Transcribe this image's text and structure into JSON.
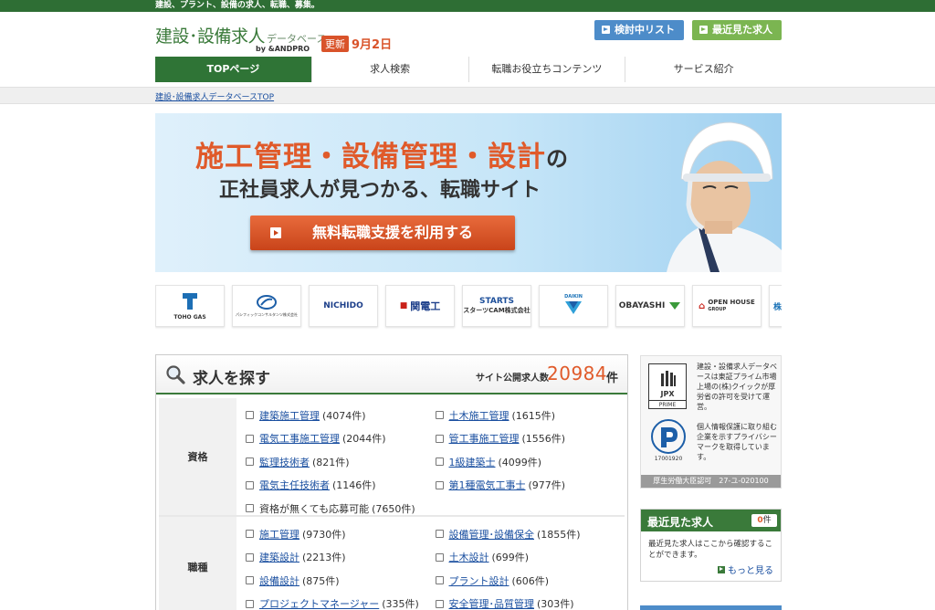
{
  "topbar": {
    "tagline": "建設、プラント、設備の求人、転職、募集。"
  },
  "header": {
    "logo_main": "建設･設備求人",
    "logo_sub": "データベース",
    "logo_by": "by &ANDPRO",
    "update_tag": "更新",
    "update_date": "9月2日",
    "btn_list": "検討中リスト",
    "btn_recent": "最近見た求人",
    "colors": {
      "brand_green": "#2f7436",
      "accent_orange": "#e05a2a",
      "btn_blue": "#4d8cc9",
      "btn_green": "#7bb551"
    }
  },
  "nav": [
    {
      "label": "TOPページ",
      "active": true
    },
    {
      "label": "求人検索"
    },
    {
      "label": "転職お役立ちコンテンツ"
    },
    {
      "label": "サービス紹介"
    }
  ],
  "breadcrumb": "建設･設備求人データベースTOP",
  "hero": {
    "headline": "施工管理・設備管理・設計",
    "headline_suffix": "の",
    "subline": "正社員求人が見つかる、転職サイト",
    "cta": "無料転職支援を利用する"
  },
  "logos": [
    {
      "name": "TOHO GAS"
    },
    {
      "name": "パシフィックコンサルタンツ株式会社"
    },
    {
      "name": "NICHIDO"
    },
    {
      "name": "関電工"
    },
    {
      "name": "STARTS"
    },
    {
      "name": "スターツCAM株式会社"
    },
    {
      "name": "DAIKIN"
    },
    {
      "name": "OBAYASHI"
    },
    {
      "name": "OPEN HOUSE"
    },
    {
      "name": "GROUP"
    },
    {
      "name": "株式会社"
    }
  ],
  "search": {
    "title": "求人を探す",
    "count_label": "サイト公開求人数",
    "count": "20984",
    "count_unit": "件",
    "rows": [
      {
        "label": "資格",
        "options": [
          {
            "text": "建築施工管理",
            "count": "(4074件)",
            "link": true
          },
          {
            "text": "土木施工管理",
            "count": "(1615件)",
            "link": true
          },
          {
            "text": "電気工事施工管理",
            "count": "(2044件)",
            "link": true
          },
          {
            "text": "管工事施工管理",
            "count": "(1556件)",
            "link": true
          },
          {
            "text": "監理技術者",
            "count": "(821件)",
            "link": true
          },
          {
            "text": "1級建築士",
            "count": "(4099件)",
            "link": true
          },
          {
            "text": "電気主任技術者",
            "count": "(1146件)",
            "link": true
          },
          {
            "text": "第1種電気工事士",
            "count": "(977件)",
            "link": true
          },
          {
            "text": "資格が無くても応募可能",
            "count": "(7650件)",
            "link": false
          }
        ]
      },
      {
        "label": "職種",
        "options": [
          {
            "text": "施工管理",
            "count": "(9730件)",
            "link": true
          },
          {
            "text": "設備管理･設備保全",
            "count": "(1855件)",
            "link": true
          },
          {
            "text": "建築設計",
            "count": "(2213件)",
            "link": true
          },
          {
            "text": "土木設計",
            "count": "(699件)",
            "link": true
          },
          {
            "text": "設備設計",
            "count": "(875件)",
            "link": true
          },
          {
            "text": "プラント設計",
            "count": "(606件)",
            "link": true
          },
          {
            "text": "プロジェクトマネージャー",
            "count": "(335件)",
            "link": true
          },
          {
            "text": "安全管理･品質管理",
            "count": "(303件)",
            "link": true
          }
        ]
      }
    ]
  },
  "sidebar": {
    "jpx_title": "JPX",
    "jpx_sub": "PRIME",
    "jpx_text": "建設・設備求人データベースは東証プライム市場上場の(株)クイックが厚労省の許可を受けて運営。",
    "privacy_text": "個人情報保護に取り組む企業を示すプライバシーマークを取得しています。",
    "privacy_no": "17001920",
    "license": "厚生労働大臣認可　27-ユ-020100",
    "recent_title": "最近見た求人",
    "recent_count": "0",
    "recent_unit": "件",
    "recent_body": "最近見た求人はここから確認することができます。",
    "recent_more": "もっと見る"
  }
}
